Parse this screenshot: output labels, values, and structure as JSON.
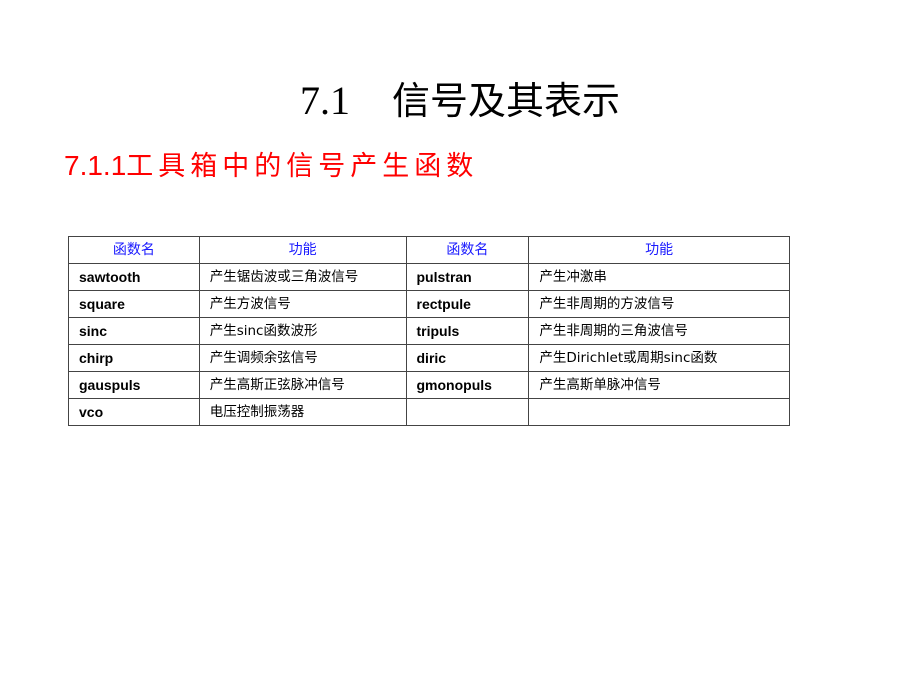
{
  "slide": {
    "title_number": "7.1",
    "title_text": "信号及其表示",
    "subtitle_number": "7.1.1",
    "subtitle_text": "工具箱中的信号产生函数"
  },
  "table": {
    "headers": [
      "函数名",
      "功能",
      "函数名",
      "功能"
    ],
    "rows": [
      {
        "name1": "sawtooth",
        "desc1": "产生锯齿波或三角波信号",
        "name2": "pulstran",
        "desc2": "产生冲激串"
      },
      {
        "name1": "square",
        "desc1": "产生方波信号",
        "name2": "rectpule",
        "desc2": "产生非周期的方波信号"
      },
      {
        "name1": "sinc",
        "desc1": "产生sinc函数波形",
        "name2": "tripuls",
        "desc2": "产生非周期的三角波信号"
      },
      {
        "name1": "chirp",
        "desc1": "产生调频余弦信号",
        "name2": "diric",
        "desc2": "产生Dirichlet或周期sinc函数"
      },
      {
        "name1": "gauspuls",
        "desc1": "产生高斯正弦脉冲信号",
        "name2": "gmonopuls",
        "desc2": "产生高斯单脉冲信号"
      },
      {
        "name1": "vco",
        "desc1": "电压控制振荡器",
        "name2": "",
        "desc2": ""
      }
    ]
  },
  "colors": {
    "subtitle": "#ff0000",
    "header_text": "#1a1aff",
    "border": "#444444"
  }
}
